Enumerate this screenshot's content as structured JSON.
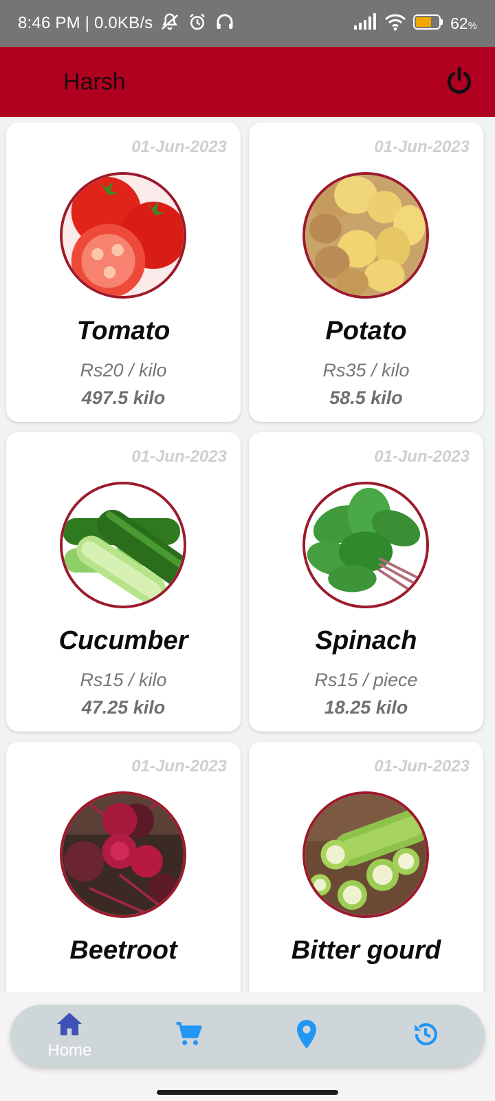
{
  "status_bar": {
    "time_speed": "8:46 PM | 0.0KB/s",
    "battery_percent": "62",
    "battery_percent_sign": "%"
  },
  "app_bar": {
    "title": "Harsh",
    "power_icon": "power-icon"
  },
  "products": [
    {
      "date": "01-Jun-2023",
      "name": "Tomato",
      "price": "Rs20 / kilo",
      "quantity": "497.5 kilo",
      "image": "tomato"
    },
    {
      "date": "01-Jun-2023",
      "name": "Potato",
      "price": "Rs35 / kilo",
      "quantity": "58.5 kilo",
      "image": "potato"
    },
    {
      "date": "01-Jun-2023",
      "name": "Cucumber",
      "price": "Rs15 / kilo",
      "quantity": "47.25 kilo",
      "image": "cucumber"
    },
    {
      "date": "01-Jun-2023",
      "name": "Spinach",
      "price": "Rs15 / piece",
      "quantity": "18.25 kilo",
      "image": "spinach"
    },
    {
      "date": "01-Jun-2023",
      "name": "Beetroot",
      "price": "",
      "quantity": "",
      "image": "beetroot"
    },
    {
      "date": "01-Jun-2023",
      "name": "Bitter gourd",
      "price": "",
      "quantity": "",
      "image": "bitter-gourd"
    }
  ],
  "bottom_nav": {
    "items": [
      {
        "label": "Home",
        "icon": "home-icon",
        "active": true
      },
      {
        "label": "",
        "icon": "cart-icon",
        "active": false
      },
      {
        "label": "",
        "icon": "location-pin-icon",
        "active": false
      },
      {
        "label": "",
        "icon": "history-icon",
        "active": false
      }
    ]
  },
  "colors": {
    "primary": "#b00020",
    "accent": "#2196f3",
    "home_active": "#3f51b5",
    "circle_border": "#9c1a2c",
    "date_text": "#cfcfcf"
  }
}
